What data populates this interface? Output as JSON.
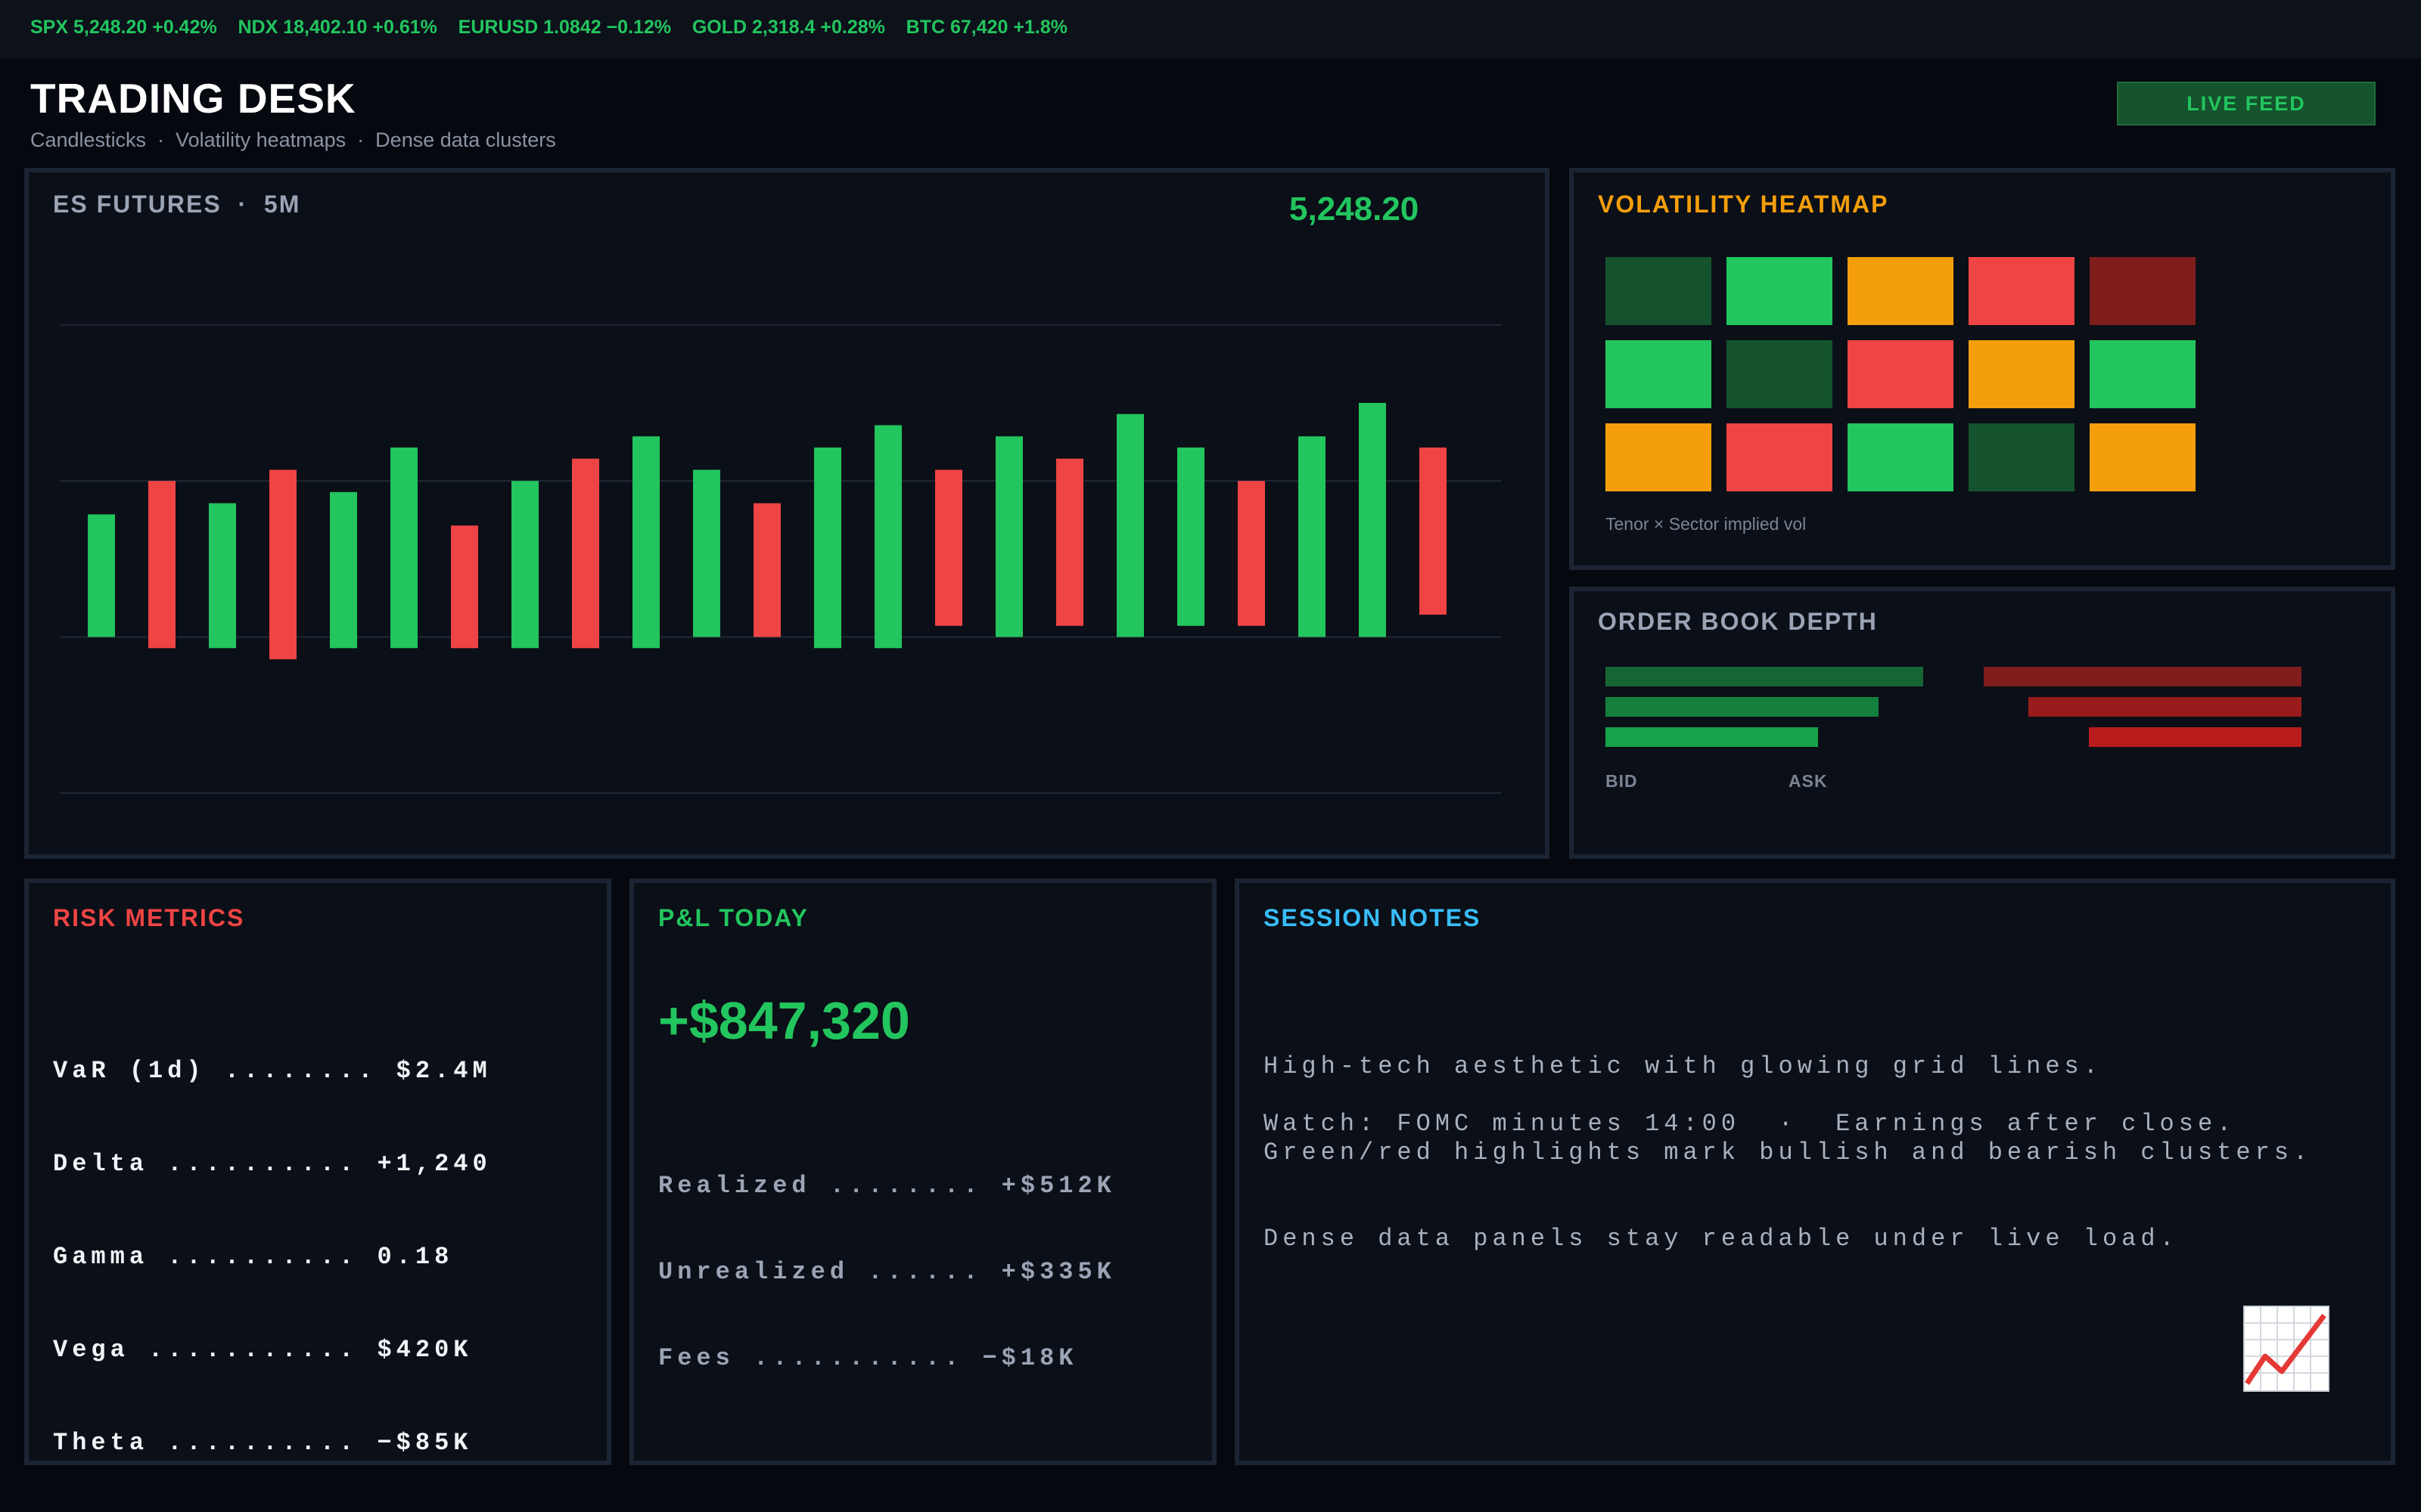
{
  "ticker": {
    "text": "SPX 5,248.20 +0.42%    NDX 18,402.10 +0.61%    EURUSD 1.0842 −0.12%    GOLD 2,318.4 +0.28%    BTC 67,420 +1.8%"
  },
  "header": {
    "title": "TRADING DESK",
    "subtitle": "Candlesticks  ·  Volatility heatmaps  ·  Dense data clusters",
    "live_label": "LIVE FEED"
  },
  "colors": {
    "bull": "#22c55e",
    "bear": "#ef4444",
    "bull_dark": "#14532d",
    "bear_dark": "#7f1d1d",
    "amber": "#f59e0b",
    "accent_blue": "#38bdf8"
  },
  "chart": {
    "title": "ES FUTURES  ·  5M",
    "price": "5,248.20"
  },
  "chart_data": {
    "type": "bar",
    "note_type": "candlestick-style floating bars",
    "series": [
      {
        "low": 0.3,
        "high": 0.85,
        "dir": "up"
      },
      {
        "low": 0.25,
        "high": 1.0,
        "dir": "down"
      },
      {
        "low": 0.25,
        "high": 0.9,
        "dir": "up"
      },
      {
        "low": 0.2,
        "high": 1.05,
        "dir": "down"
      },
      {
        "low": 0.25,
        "high": 0.95,
        "dir": "up"
      },
      {
        "low": 0.25,
        "high": 1.15,
        "dir": "up"
      },
      {
        "low": 0.25,
        "high": 0.8,
        "dir": "down"
      },
      {
        "low": 0.25,
        "high": 1.0,
        "dir": "up"
      },
      {
        "low": 0.25,
        "high": 1.1,
        "dir": "down"
      },
      {
        "low": 0.25,
        "high": 1.2,
        "dir": "up"
      },
      {
        "low": 0.3,
        "high": 1.05,
        "dir": "up"
      },
      {
        "low": 0.3,
        "high": 0.9,
        "dir": "down"
      },
      {
        "low": 0.25,
        "high": 1.15,
        "dir": "up"
      },
      {
        "low": 0.25,
        "high": 1.25,
        "dir": "up"
      },
      {
        "low": 0.35,
        "high": 1.05,
        "dir": "down"
      },
      {
        "low": 0.3,
        "high": 1.2,
        "dir": "up"
      },
      {
        "low": 0.35,
        "high": 1.1,
        "dir": "down"
      },
      {
        "low": 0.3,
        "high": 1.3,
        "dir": "up"
      },
      {
        "low": 0.35,
        "high": 1.15,
        "dir": "up"
      },
      {
        "low": 0.35,
        "high": 1.0,
        "dir": "down"
      },
      {
        "low": 0.3,
        "high": 1.2,
        "dir": "up"
      },
      {
        "low": 0.3,
        "high": 1.35,
        "dir": "up"
      },
      {
        "low": 0.4,
        "high": 1.15,
        "dir": "down"
      }
    ],
    "ylim": [
      -0.6,
      1.95
    ],
    "gridlines": [
      -0.4,
      0.3,
      1.0,
      1.7
    ],
    "grid": true,
    "title": "ES FUTURES  ·  5M",
    "xlabel": "",
    "ylabel": ""
  },
  "heatmap": {
    "title": "VOLATILITY HEATMAP",
    "caption": "Tenor × Sector implied vol",
    "rows": [
      [
        "bull_dark",
        "bull",
        "amber",
        "bear",
        "bear_dark"
      ],
      [
        "bull",
        "bull_dark",
        "bear",
        "amber",
        "bull"
      ],
      [
        "amber",
        "bear",
        "bull",
        "bull_dark",
        "amber"
      ]
    ]
  },
  "orderbook": {
    "title": "ORDER BOOK DEPTH",
    "bid_label": "BID",
    "ask_label": "ASK",
    "bids": [
      1.0,
      0.86,
      0.67
    ],
    "asks": [
      1.0,
      0.86,
      0.67
    ]
  },
  "risk": {
    "title": "RISK METRICS",
    "lines": [
      "VaR (1d) ........ $2.4M",
      "Delta .......... +1,240",
      "Gamma .......... 0.18",
      "Vega ........... $420K",
      "Theta .......... −$85K"
    ]
  },
  "pnl": {
    "title": "P&L TODAY",
    "total": "+$847,320",
    "lines": [
      "Realized ........ +$512K",
      "Unrealized ...... +$335K",
      "Fees ........... −$18K"
    ]
  },
  "notes": {
    "title": "SESSION NOTES",
    "lines": [
      "High-tech aesthetic with glowing grid lines.",
      "Green/red highlights mark bullish and bearish clusters.",
      "Dense data panels stay readable under live load."
    ],
    "watch": "Watch: FOMC minutes 14:00  ·  Earnings after close.",
    "icon": "chart-increasing-icon"
  }
}
